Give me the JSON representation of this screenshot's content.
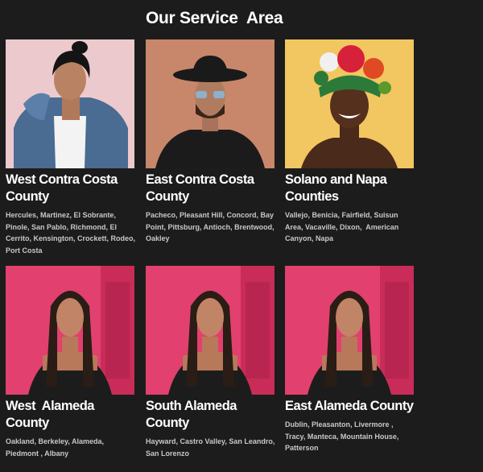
{
  "section": {
    "title": "Our Service  Area"
  },
  "cards": [
    {
      "title": "West Contra Costa County",
      "cities": "Hercules, Martinez, El Sobrante, Pinole, San Pablo, Richmond, El Cerrito, Kensington, Crockett, Rodeo, Port Costa"
    },
    {
      "title": "East Contra Costa County",
      "cities": "Pacheco, Pleasant Hill, Concord, Bay Point, Pittsburg, Antioch, Brentwood, Oakley"
    },
    {
      "title": "Solano and Napa Counties",
      "cities": "Vallejo, Benicia, Fairfield, Suisun Area, Vacaville, Dixon,  American Canyon, Napa"
    },
    {
      "title": "West  Alameda County",
      "cities": "Oakland, Berkeley, Alameda, Piedmont , Albany"
    },
    {
      "title": "South Alameda County",
      "cities": "Hayward, Castro Valley, San Leandro, San Lorenzo"
    },
    {
      "title": "East Alameda County",
      "cities": "Dublin, Pleasanton, Livermore , Tracy, Manteca, Mountain House, Patterson"
    }
  ]
}
